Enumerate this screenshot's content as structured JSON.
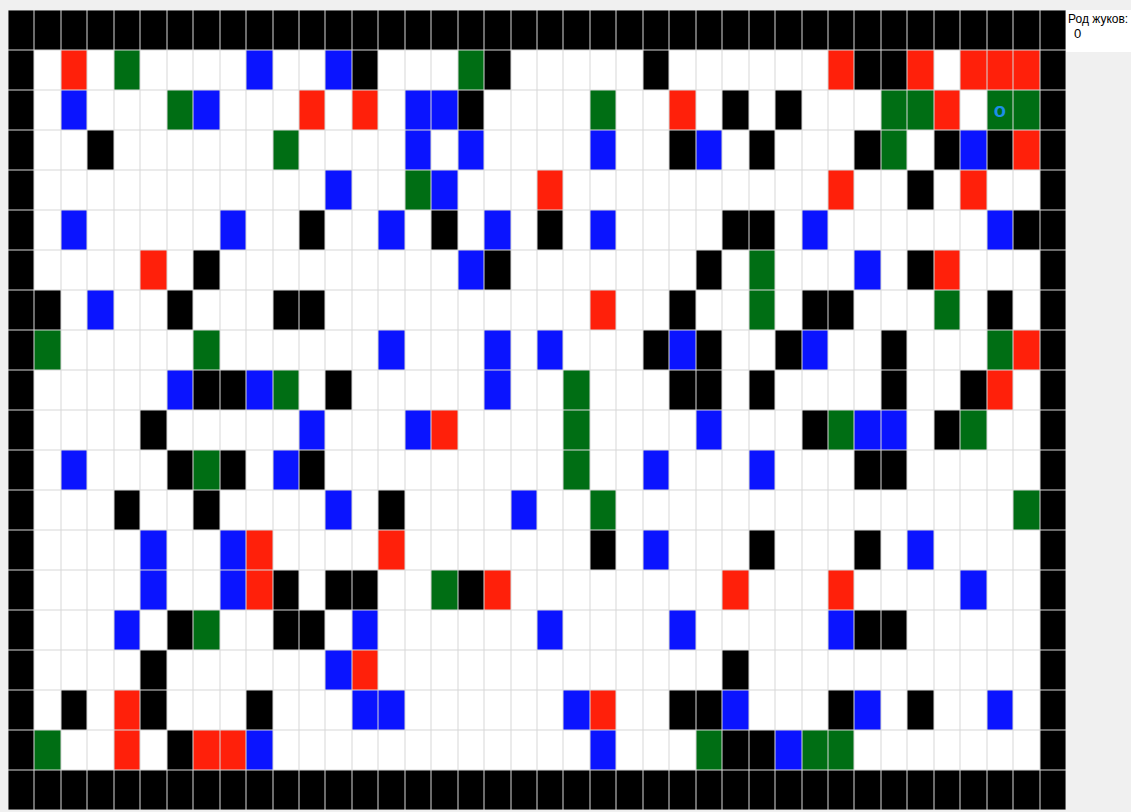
{
  "board": {
    "legend": [
      {
        "code": "K",
        "kind": "wall",
        "color": "#000000"
      },
      {
        "code": "W",
        "kind": "empty",
        "color": "#ffffff"
      },
      {
        "code": "R",
        "kind": "poison",
        "color": "#ff200a"
      },
      {
        "code": "G",
        "kind": "food",
        "color": "#006e14"
      },
      {
        "code": "B",
        "kind": "bug",
        "color": "#0a14ff"
      }
    ],
    "rows": [
      "KKKKKKKKKKKKKKKKKKKKKKKKKKKKKKKKKKKKKKKK",
      "KWRWGWWWWBWWBKWWWGKWWWWWKWWWWWWRKKRWRRRK",
      "KWBWWWGBWWWRWRWBBKWWWWGWWRWKWKWWWGGRWGGK",
      "KWWKWWWWWWGWWWWBWBWWWWBWWKBWKWWWKGWKBKRK",
      "KWWWWWWWWWWWBWWGBWWWRWWWWWWWWWWRWWKWRWWK",
      "KWBWWWWWBWWKWWBWKWBWKWBWWWWKKWBWWWWWWBKK",
      "KWWWWRWKWWWWWWWWWBKWWWWWWWKWGWWWBWKRWWWK",
      "KKWBWWKWWWKKWWWWWWWWWWRWWKWWGWKKWWWGWKWK",
      "KGWWWWWGWWWWWWBWWWBWBWWWKBKWWKBWWKWWWGRK",
      "KWWWWWBKKBGWKWWWWWBWWGWWWKKWKWWWWKWWKRWK",
      "KWWWWKWWWWWBWWWBRWWWWGWWWWBWWWKGBBWKGWWK",
      "KWBWWWKGKWBKWWWWWWWWWGWWBWWWBWWWKKWWWWWK",
      "KWWWKWWKWWWWBWKWWWWBWWGWWWWWWWWWWWWWWWGK",
      "KWWWWBWWBRWWWWRWWWWWWWKWBWWWKWWWKWBWWWWK",
      "KWWWWBWWBRKWKKWWGKRWWWWWWWWRWWWRWWWWBWWK",
      "KWWWBWKGWWKKWBWWWWWWBWWWWBWWWWWBKKWWWWWK",
      "KWWWWKWWWWWWBRWWWWWWWWWWWWWKWWWWWWWWWWWK",
      "KWKWRKWWWKWWWBBWWWWWWBRWWKKBWWWKBWKWWBWK",
      "KGWWRWKRRBWWWWWWWWWWWWBWWWGKKBGGWWWWWWWK",
      "KKKKKKKKKKKKKKKKKKKKKKKKKKKKKKKKKKKKKKKK"
    ],
    "marker": {
      "text": "o",
      "row": 2,
      "col": 37
    }
  },
  "sidebar": {
    "label": "Род жуков:",
    "value": "0"
  }
}
